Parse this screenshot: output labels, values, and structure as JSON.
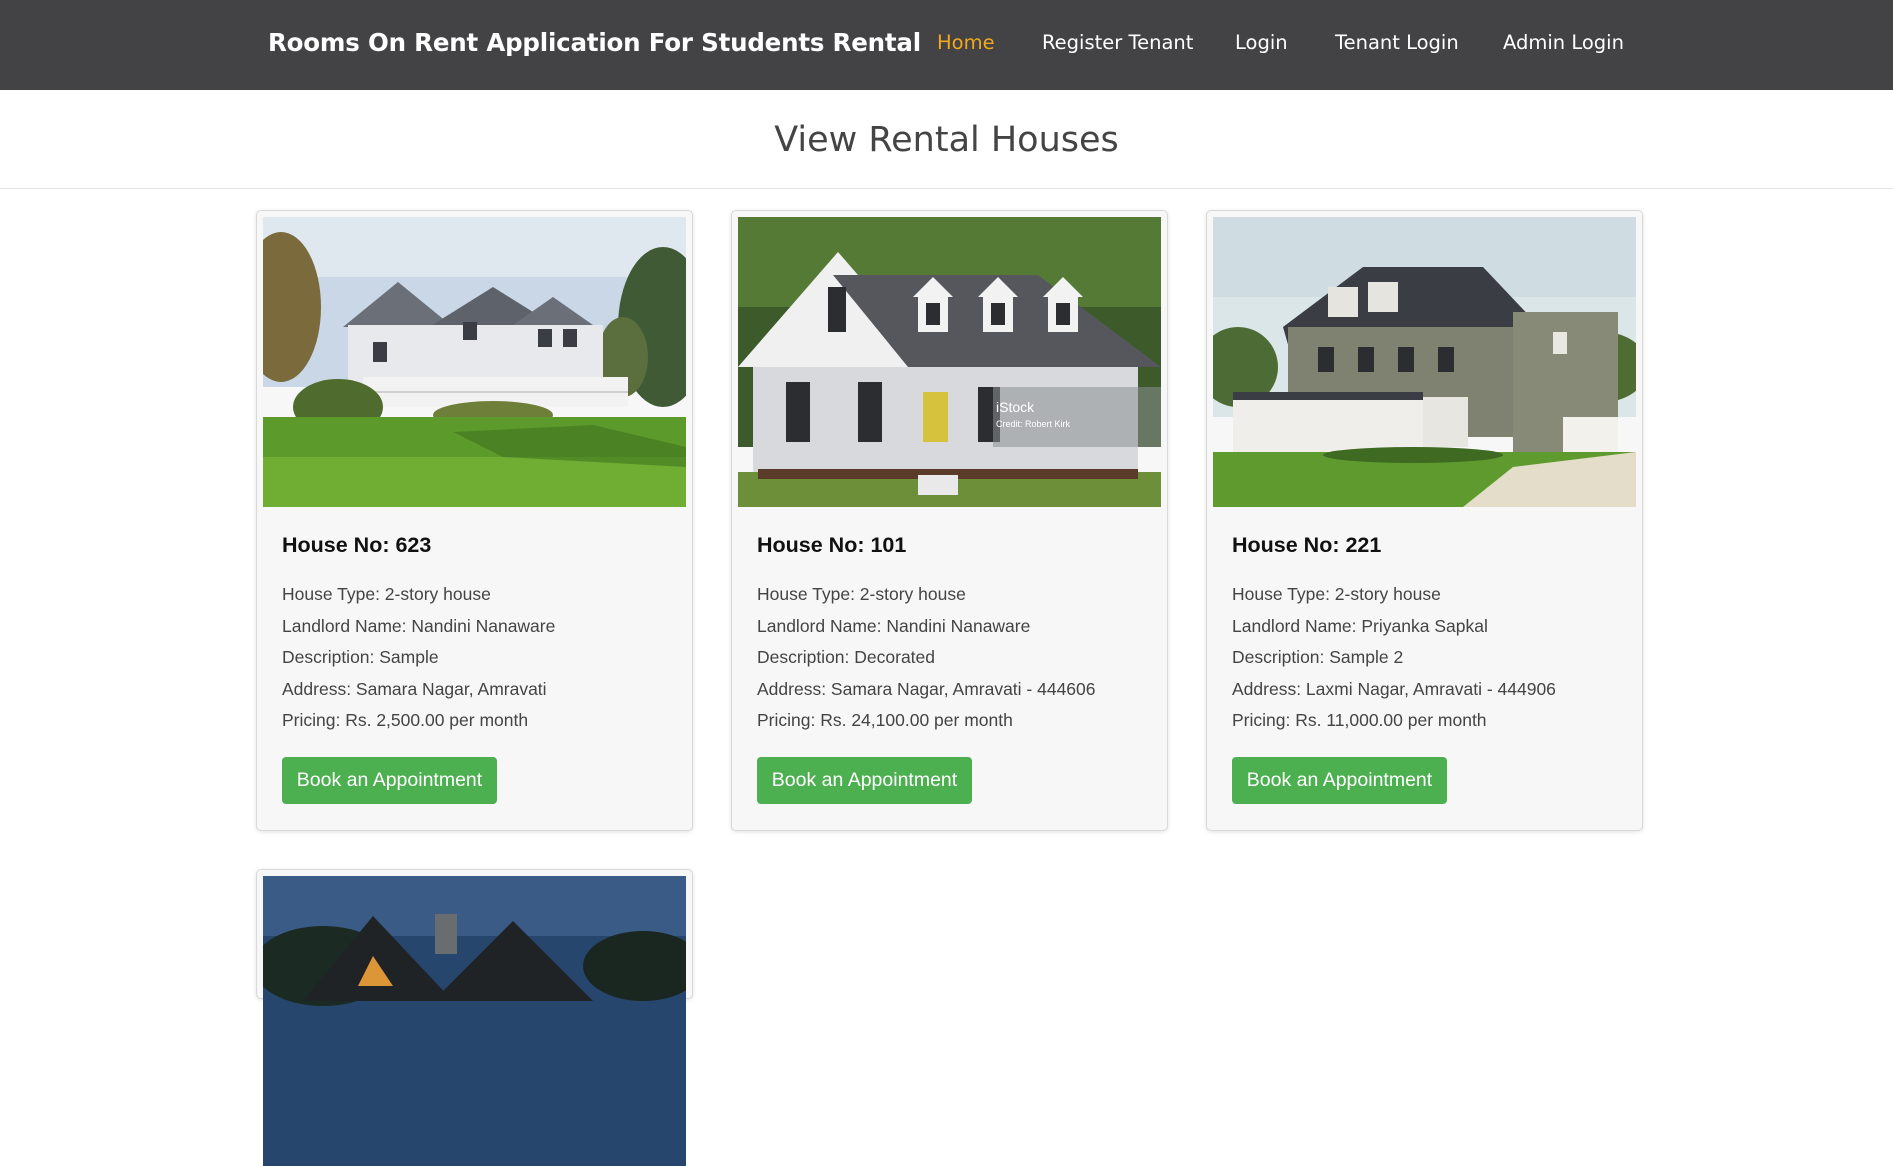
{
  "navbar": {
    "brand": "Rooms On Rent Application For Students Rental",
    "links": [
      {
        "label": "Home",
        "active": true
      },
      {
        "label": "Register Tenant",
        "active": false
      },
      {
        "label": "Login",
        "active": false
      },
      {
        "label": "Tenant Login",
        "active": false
      },
      {
        "label": "Admin Login",
        "active": false
      }
    ]
  },
  "page": {
    "heading": "View Rental Houses"
  },
  "houses": [
    {
      "title": "House No: 623",
      "house_type": "House Type: 2-story house",
      "landlord": "Landlord Name: Nandini Nanaware",
      "description": "Description: Sample",
      "address": "Address: Samara Nagar, Amravati",
      "pricing": "Pricing: Rs. 2,500.00 per month",
      "button": "Book an Appointment"
    },
    {
      "title": "House No: 101",
      "house_type": "House Type: 2-story house",
      "landlord": "Landlord Name: Nandini Nanaware",
      "description": "Description: Decorated",
      "address": "Address: Samara Nagar, Amravati - 444606",
      "pricing": "Pricing: Rs. 24,100.00 per month",
      "button": "Book an Appointment",
      "photo_watermark": "iStock",
      "photo_credit": "Credit: Robert Kirk"
    },
    {
      "title": "House No: 221",
      "house_type": "House Type: 2-story house",
      "landlord": "Landlord Name: Priyanka Sapkal",
      "description": "Description: Sample 2",
      "address": "Address: Laxmi Nagar, Amravati - 444906",
      "pricing": "Pricing: Rs. 11,000.00 per month",
      "button": "Book an Appointment"
    }
  ],
  "colors": {
    "navbar_bg": "#434245",
    "nav_active": "#f2a81d",
    "button_bg": "#4caf50",
    "card_bg": "#f7f7f7"
  }
}
